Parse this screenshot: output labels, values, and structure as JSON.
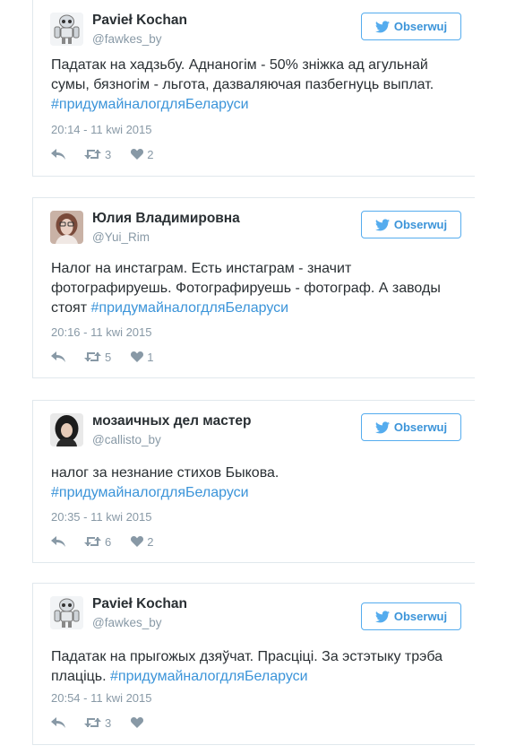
{
  "follow_label": "Obserwuj",
  "colors": {
    "link": "#3b94d9",
    "follow_border": "#55acee",
    "meta": "#8899a6",
    "text": "#292f33",
    "border": "#e1e8ed"
  },
  "tweets": [
    {
      "name": "Pavieł Kochan",
      "handle": "@fawkes_by",
      "avatar": "robot-avatar",
      "text": "Падатак на хадзьбу. Аднаногім - 50% зніжка ад агульнай сумы, бязногім - льгота, дазваляючая пазбегнуць выплат.",
      "hashtag": "#придумайналогдляБеларуси",
      "date": "20:14 - 11 kwi 2015",
      "retweets": "3",
      "likes": "2"
    },
    {
      "name": "Юлия Владимировна",
      "handle": "@Yui_Rim",
      "avatar": "woman-photo-avatar",
      "text": "Налог на инстаграм. Есть инстаграм - значит фотографируешь. Фотографируешь - фотограф. А заводы стоят",
      "hashtag": "#придумайналогдляБеларуси",
      "date": "20:16 - 11 kwi 2015",
      "retweets": "5",
      "likes": "1"
    },
    {
      "name": "мозаичных дел мастер",
      "handle": "@callisto_by",
      "avatar": "dark-hair-photo-avatar",
      "text": "налог за незнание стихов Быкова.",
      "hashtag": "#придумайналогдляБеларуси",
      "date": "20:35 - 11 kwi 2015",
      "retweets": "6",
      "likes": "2"
    },
    {
      "name": "Pavieł Kochan",
      "handle": "@fawkes_by",
      "avatar": "robot-avatar",
      "text": "Падатак на прыгожых дзяўчат. Прасціці. За эстэтыку трэба плаціць.",
      "hashtag": "#придумайналогдляБеларуси",
      "date": "20:54 - 11 kwi 2015",
      "retweets": "3",
      "likes": ""
    }
  ]
}
